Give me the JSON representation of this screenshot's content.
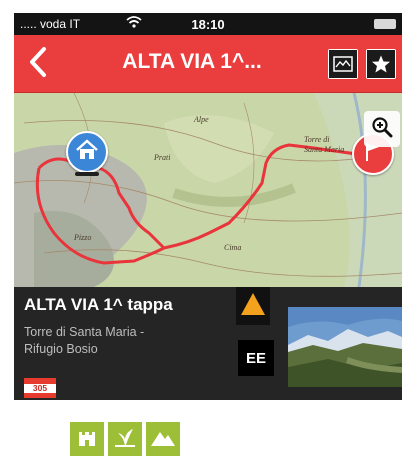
{
  "status_bar": {
    "carrier": "..... voda IT",
    "time": "18:10",
    "wifi_icon": "wifi-icon",
    "battery_icon": "battery-icon"
  },
  "nav_bar": {
    "title": "ALTA VIA 1^...",
    "back_icon": "chevron-left-icon",
    "profile_icon": "elevation-chart-icon",
    "favorite_icon": "star-icon",
    "color": "#ea3d3d"
  },
  "map": {
    "start_pin_icon": "home-icon",
    "end_pin_icon": "flag-icon",
    "zoom_icon": "zoom-in-icon",
    "route_color": "#e8343a",
    "places": [
      "Torre di",
      "Santa Maria",
      "Alpe",
      "Prati",
      "Pizzo",
      "Cima"
    ]
  },
  "route_info": {
    "name": "ALTA VIA 1^ tappa",
    "from": "Torre di Santa Maria -",
    "to": "Rifugio Bosio",
    "trail_number": "305",
    "difficulty": "EE",
    "difficulty_icon": "warning-triangle-icon",
    "difficulty_color": "#f4a21d"
  },
  "activities": [
    {
      "icon": "castle-icon"
    },
    {
      "icon": "plant-icon"
    },
    {
      "icon": "mountain-icon"
    }
  ],
  "colors": {
    "activity_green": "#9dbf37",
    "info_background": "#252525"
  }
}
